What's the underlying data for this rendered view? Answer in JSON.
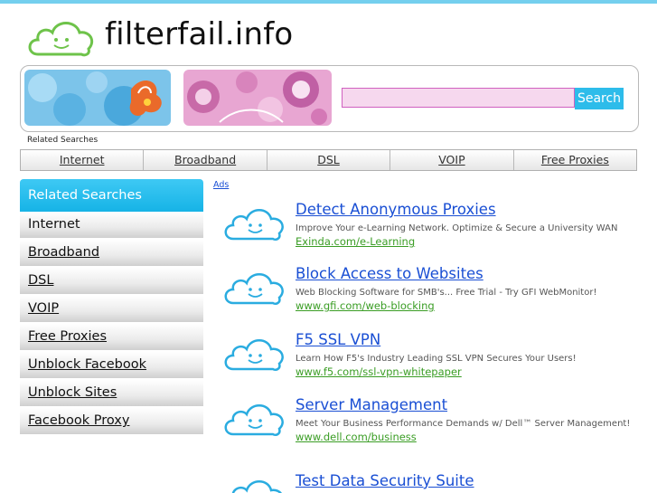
{
  "site": {
    "name": "filterfail.info"
  },
  "search": {
    "value": "",
    "button_label": "Search"
  },
  "related_label": "Related Searches",
  "topnav": [
    "Internet",
    "Broadband",
    "DSL",
    "VOIP",
    "Free Proxies"
  ],
  "sidebar": {
    "header": "Related Searches",
    "items": [
      "Internet",
      "Broadband",
      "DSL",
      "VOIP",
      "Free Proxies",
      "Unblock Facebook",
      "Unblock Sites",
      "Facebook Proxy"
    ]
  },
  "ads_label": "Ads",
  "ads": [
    {
      "title": "Detect Anonymous Proxies",
      "desc": "Improve Your e-Learning Network. Optimize & Secure a University WAN",
      "url": "Exinda.com/e-Learning"
    },
    {
      "title": "Block Access to Websites",
      "desc": "Web Blocking Software for SMB's... Free Trial - Try GFI WebMonitor!",
      "url": "www.gfi.com/web-blocking"
    },
    {
      "title": "F5 SSL VPN",
      "desc": "Learn How F5's Industry Leading SSL VPN Secures Your Users!",
      "url": "www.f5.com/ssl-vpn-whitepaper"
    },
    {
      "title": "Server Management",
      "desc": "Meet Your Business Performance Demands w/ Dell™ Server Management!",
      "url": "www.dell.com/business"
    },
    {
      "title": "Test Data Security Suite",
      "desc": "",
      "url": ""
    }
  ],
  "colors": {
    "accent": "#2dbcea",
    "link": "#1a4fd4",
    "url_green": "#3a9d24",
    "search_bg": "#f6d8ee"
  },
  "icons": {
    "logo": "cloud-smiley-icon",
    "ad": "cloud-smiley-icon"
  }
}
